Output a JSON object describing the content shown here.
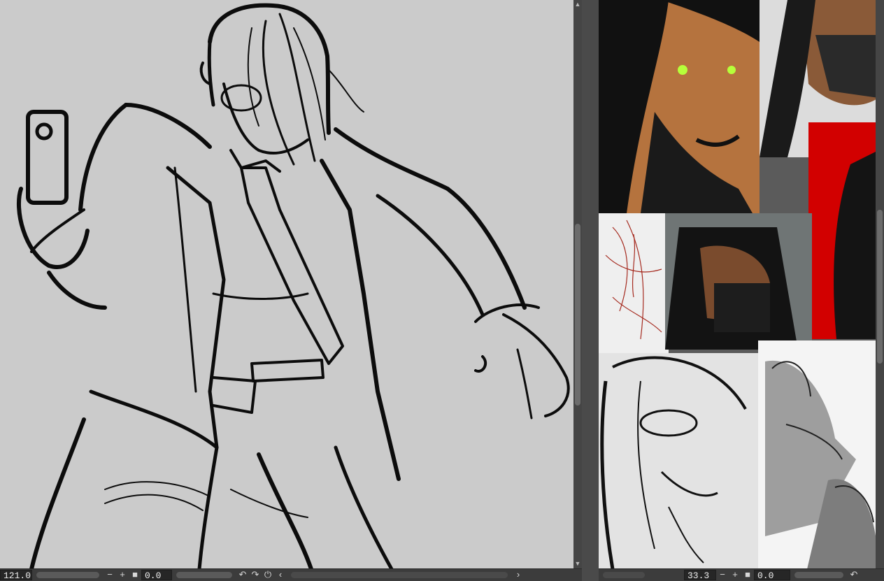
{
  "left_canvas": {
    "zoom": "121.0",
    "rotation": "0.0",
    "colors": {
      "paper": "#cbcbcb",
      "ink": "#0c0c0c"
    }
  },
  "right_canvas": {
    "zoom": "33.3",
    "rotation": "0.0"
  },
  "icons": {
    "zoom_out": "−",
    "zoom_in": "+",
    "fit": "■",
    "undo": "↶",
    "redo": "↷",
    "reset_rotation": "⏻",
    "scroll_left": "‹",
    "scroll_right": "›",
    "scroll_up": "▲",
    "scroll_down": "▼"
  },
  "reference_colors": {
    "red_panel": "#d20000",
    "eye_green": "#b6ff3a",
    "skin": "#b5733e",
    "sketch_red": "#a52a1f"
  }
}
